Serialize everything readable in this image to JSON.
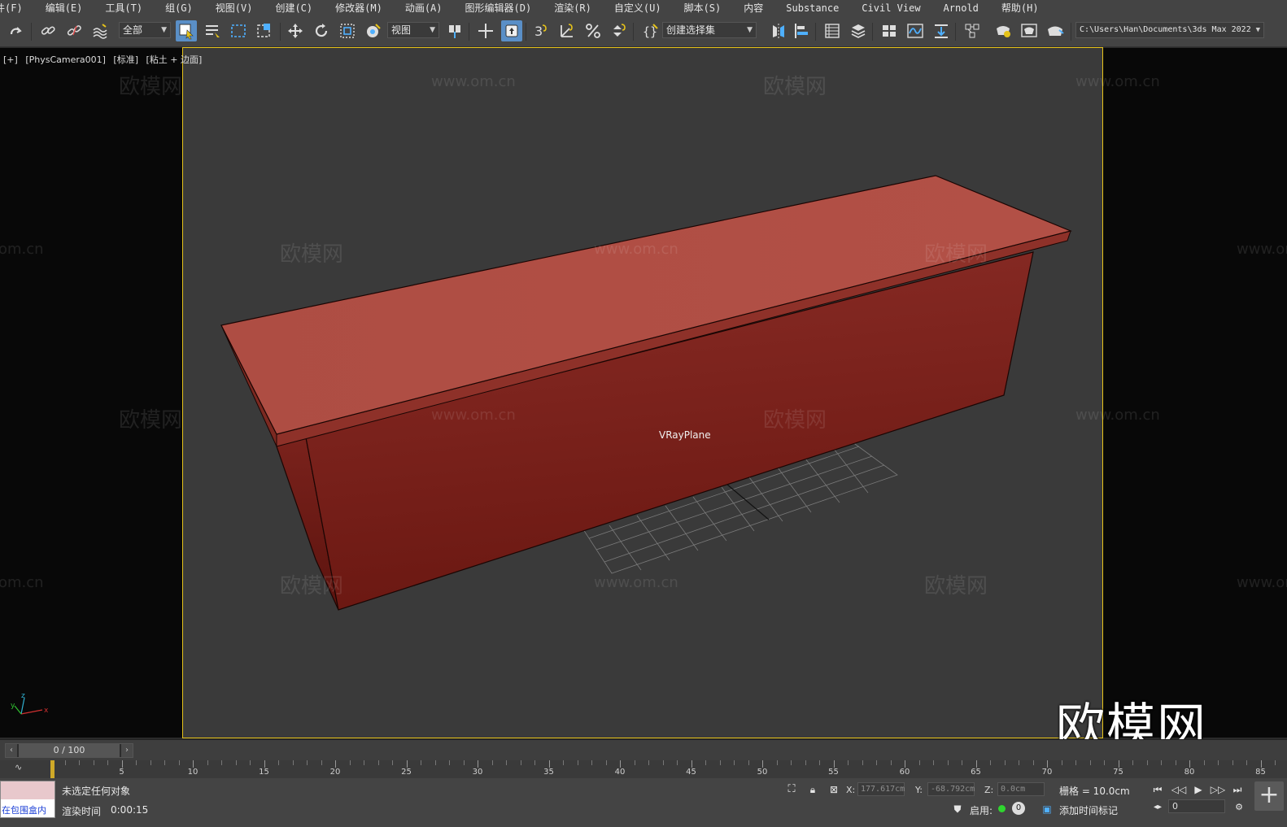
{
  "menu": [
    "件(F)",
    "编辑(E)",
    "工具(T)",
    "组(G)",
    "视图(V)",
    "创建(C)",
    "修改器(M)",
    "动画(A)",
    "图形编辑器(D)",
    "渲染(R)",
    "自定义(U)",
    "脚本(S)",
    "内容",
    "Substance",
    "Civil View",
    "Arnold",
    "帮助(H)"
  ],
  "toolbar": {
    "selection_filter": "全部",
    "reference_coord": "视图",
    "named_selection": "创建选择集",
    "project_path": "C:\\Users\\Han\\Documents\\3ds Max 2022",
    "snap_label": "3"
  },
  "viewport": {
    "labels": [
      "[+]",
      "[PhysCamera001]",
      "[标准]",
      "[粘土 + 边面]"
    ],
    "object_label": "VRayPlane",
    "watermark_text": "欧模网",
    "watermark_url": "www.om.cn",
    "watermark_url_partial": "om.cn",
    "big_logo": "欧模网",
    "colors": {
      "border": "#e6c319",
      "object": "#a8453c",
      "background": "#3a3a3a"
    }
  },
  "timeslider": {
    "frame_text": "0 / 100",
    "ticks": [
      "5",
      "10",
      "15",
      "20",
      "25",
      "30",
      "35",
      "40",
      "45",
      "50",
      "55",
      "60",
      "65",
      "70",
      "75",
      "80",
      "85"
    ]
  },
  "status": {
    "maxscript_text": "在包围盒内",
    "selection_text": "未选定任何对象",
    "render_time_label": "渲染时间",
    "render_time_value": "0:00:15",
    "x_label": "X:",
    "x_value": "177.617cm",
    "y_label": "Y:",
    "y_value": "-68.792cm",
    "z_label": "Z:",
    "z_value": "0.0cm",
    "grid": "栅格 = 10.0cm",
    "enable_label": "启用:",
    "enable_count": "0",
    "add_time_tag": "添加时间标记",
    "frame_value": "0"
  }
}
